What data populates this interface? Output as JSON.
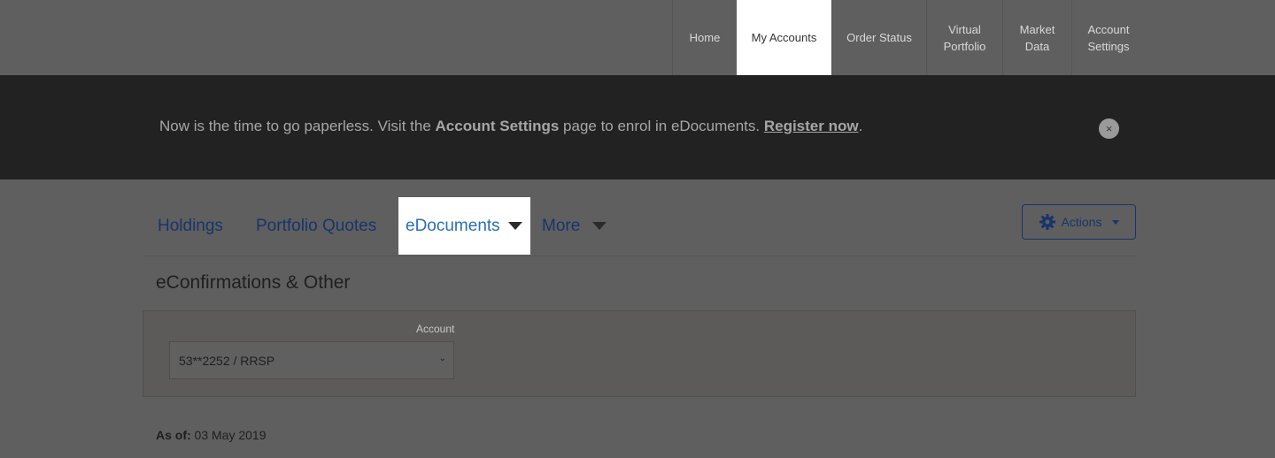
{
  "top_nav": {
    "items": [
      {
        "label": "Home"
      },
      {
        "label": "My Accounts",
        "active": true
      },
      {
        "label": "Order Status"
      },
      {
        "label": "Virtual\nPortfolio"
      },
      {
        "label": "Market\nData"
      },
      {
        "label": "Account\nSettings"
      }
    ]
  },
  "banner": {
    "text_before": "Now is the time to go paperless. Visit the ",
    "bold": "Account Settings",
    "text_middle": " page to enrol in eDocuments. ",
    "link": "Register now",
    "text_after": ".",
    "close_label": "×"
  },
  "tabs": {
    "items": [
      {
        "label": "Holdings"
      },
      {
        "label": "Portfolio Quotes"
      },
      {
        "label": "eDocuments",
        "active": true
      },
      {
        "label": "More"
      }
    ],
    "actions_label": "Actions"
  },
  "section": {
    "title": "eConfirmations & Other",
    "account_label": "Account",
    "account_value": "53**2252 / RRSP",
    "as_of_label": "As of:",
    "as_of_value": " 03 May 2019"
  },
  "colors": {
    "banner_bg": "#222222",
    "link_blue": "#17356a",
    "active_tab_blue": "#2a6fb8"
  }
}
